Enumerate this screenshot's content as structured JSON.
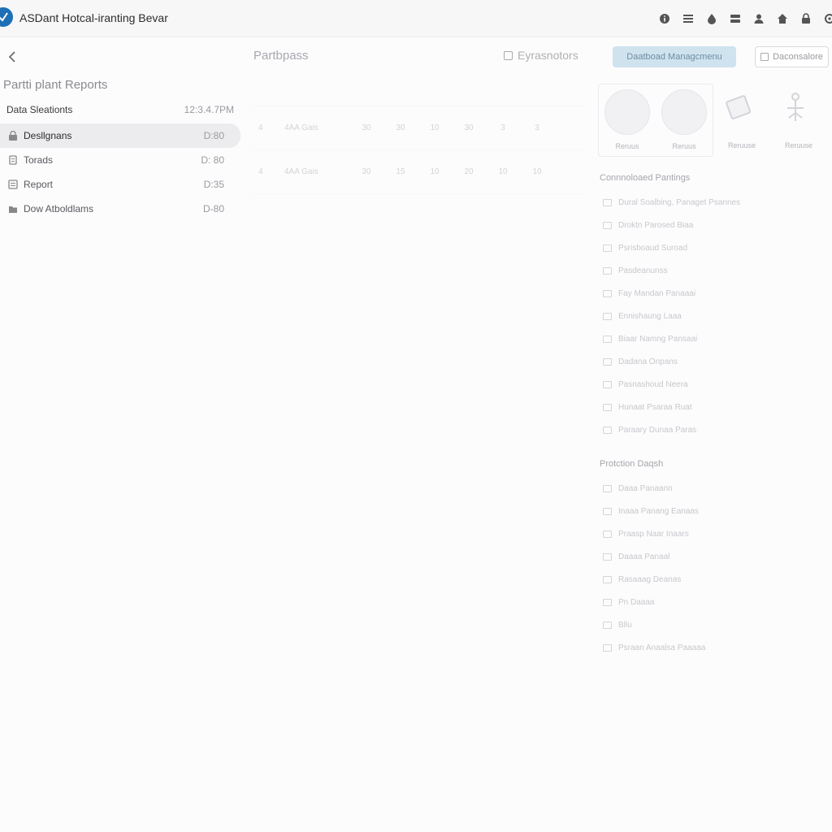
{
  "app": {
    "title": "ASDant Hotcal-iranting Bevar"
  },
  "sidebar": {
    "title": "Partti plant Reports",
    "header_label": "Data Sleationts",
    "header_time": "12:3.4.7PM",
    "items": [
      {
        "label": "Desllgnans",
        "value": "D:80",
        "icon": "lock-icon",
        "active": true
      },
      {
        "label": "Torads",
        "value": "D: 80",
        "icon": "file-icon",
        "active": false
      },
      {
        "label": "Report",
        "value": "D:35",
        "icon": "list-icon",
        "active": false
      },
      {
        "label": "Dow Atboldlams",
        "value": "D-80",
        "icon": "folder-icon",
        "active": false
      }
    ]
  },
  "main": {
    "heading": "Partbpass",
    "link_label": "Eyrasnotors",
    "primary_button": "Daatboad Managcmenu",
    "outline_button": "Daconsalore",
    "table": {
      "headers": [
        "",
        "",
        "",
        "",
        "",
        "",
        "",
        "",
        ""
      ],
      "rows": [
        [
          "4",
          "4AA Gais",
          "30",
          "30",
          "10",
          "30",
          "3",
          "3"
        ],
        [
          "4",
          "4AA Gais",
          "30",
          "15",
          "10",
          "20",
          "10",
          "10"
        ]
      ]
    }
  },
  "right_panel": {
    "cards": [
      {
        "caption": "Reruus"
      },
      {
        "caption": "Reruus"
      },
      {
        "caption": "Reruuse"
      },
      {
        "caption": "Reruuse"
      }
    ],
    "section1_title": "Connnoloaed Pantings",
    "section1_items": [
      "Dural Soalbing, Panaget Psannes",
      "Droktn Parosed Biaa",
      "Psrisboaud Suroad",
      "Pasdeanunss",
      "Fay Mandan Panaaai",
      "Ennishaung Laaa",
      "Biaar Namng Pansaai",
      "Dadana Onpans",
      "Pasnashoud Neera",
      "Hunaat Psaraa Ruat",
      "Paraary Dunaa Paras"
    ],
    "section2_title": "Protction Daqsh",
    "section2_items": [
      "Daaa Panaann",
      "Inaaa Panang Eanaas",
      "Praasp Naar Inaars",
      "Daaaa Panaal",
      "Rasaaag Deanas",
      "Pn Daaaa",
      "Bllu",
      "Psraan Anaalsa Paaaaa"
    ]
  },
  "colors": {
    "brand": "#1e6fb5",
    "primary_button_bg": "#cfe3ef",
    "active_item_bg": "#ececee"
  }
}
